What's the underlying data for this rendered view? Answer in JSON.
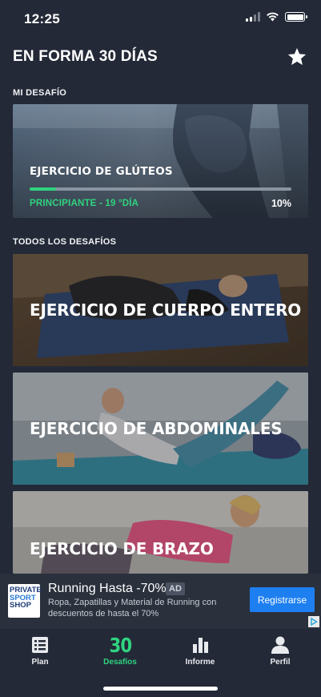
{
  "status": {
    "time": "12:25"
  },
  "header": {
    "title": "EN FORMA 30 DÍAS"
  },
  "my_challenge": {
    "section_label": "MI DESAFÍO",
    "title": "EJERCICIO DE GLÚTEOS",
    "level": "PRINCIPIANTE - 19 °DÍA",
    "percent": "10%",
    "progress": 0.1
  },
  "all_challenges": {
    "section_label": "TODOS LOS DESAFÍOS",
    "items": [
      {
        "title": "EJERCICIO DE CUERPO ENTERO"
      },
      {
        "title": "EJERCICIO DE ABDOMINALES"
      },
      {
        "title": "EJERCICIO DE BRAZO"
      }
    ]
  },
  "ad": {
    "logo_line1": "PRIVATE",
    "logo_line2": "SPORT",
    "logo_line3": "SHOP",
    "title": "Running Hasta -70%",
    "badge": "AD",
    "description": "Ropa, Zapatillas y Material de Running con descuentos de hasta el 70%",
    "cta": "Registrarse"
  },
  "tabs": [
    {
      "label": "Plan",
      "icon": "list-icon"
    },
    {
      "label": "Desafíos",
      "number": "30",
      "active": true
    },
    {
      "label": "Informe",
      "icon": "bar-chart-icon"
    },
    {
      "label": "Perfil",
      "icon": "person-icon"
    }
  ],
  "colors": {
    "accent": "#2fd37f",
    "background": "#232937",
    "ad_button": "#1e7ff0"
  }
}
